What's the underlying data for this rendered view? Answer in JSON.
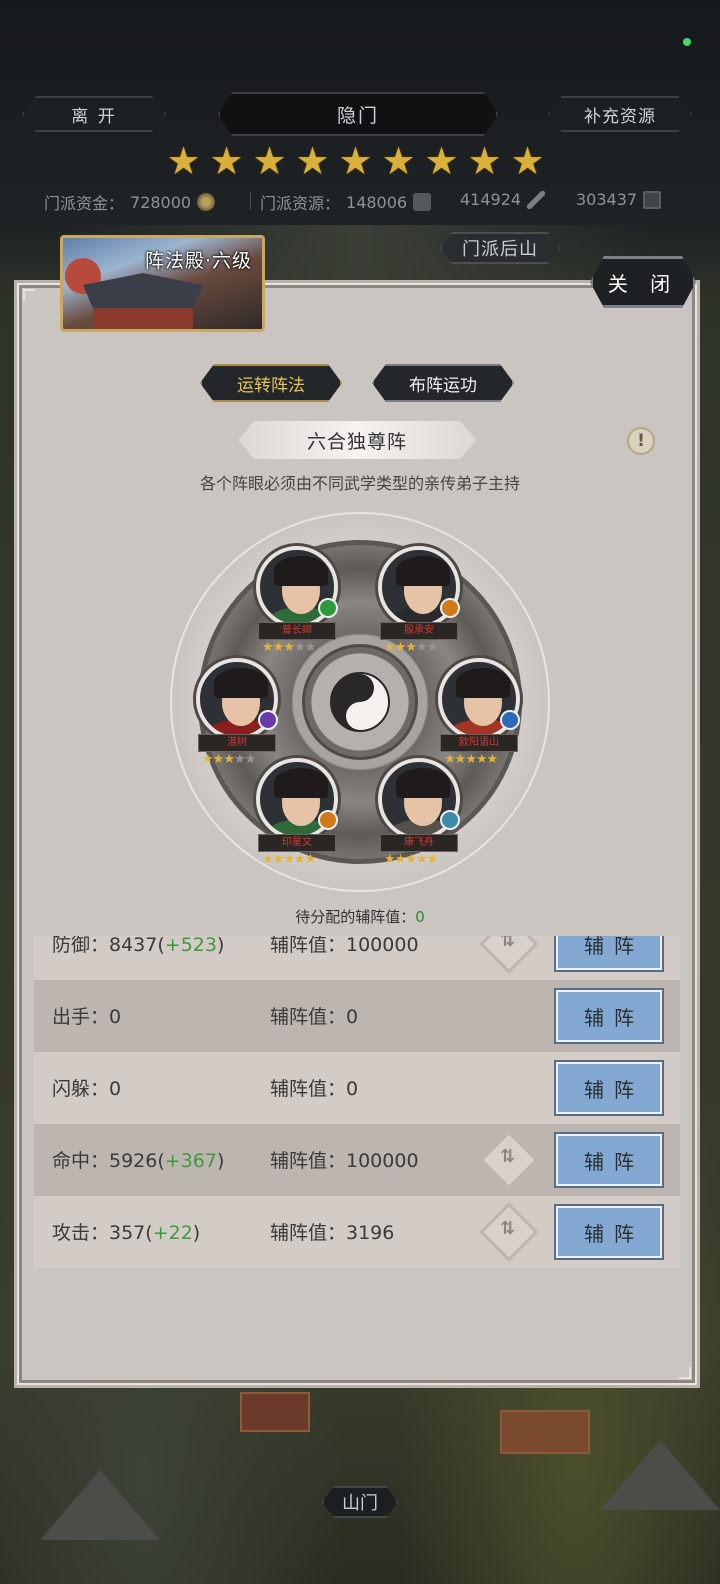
{
  "header": {
    "leave_label": "离 开",
    "title": "隐门",
    "resupply_label": "补充资源",
    "star_count": 9,
    "resources": [
      {
        "label": "门派资金：",
        "value": "728000",
        "icon": "coin-icon"
      },
      {
        "label": "门派资源：",
        "value": "148006",
        "icon": "bag-icon"
      },
      {
        "label": "",
        "value": "414924",
        "icon": "sword-icon"
      },
      {
        "label": "",
        "value": "303437",
        "icon": "box-icon"
      }
    ]
  },
  "map": {
    "back_mountain_label": "门派后山",
    "gate_label": "山门"
  },
  "panel": {
    "hall_title": "阵法殿·六级",
    "close_label": "关 闭",
    "tabs": [
      {
        "label": "运转阵法",
        "active": true
      },
      {
        "label": "布阵运功",
        "active": false
      }
    ],
    "formation_name": "六合独尊阵",
    "info_icon_text": "!",
    "rule_text": "各个阵眼必须由不同武学类型的亲传弟子主持",
    "disciples": [
      {
        "name": "曾长卿",
        "stars": 3,
        "max_stars": 5,
        "robe": "#2f6a3a",
        "badge": "#2e9a3e"
      },
      {
        "name": "殷承安",
        "stars": 3,
        "max_stars": 5,
        "robe": "#2a2a2e",
        "badge": "#d07a1a"
      },
      {
        "name": "湛树",
        "stars": 3,
        "max_stars": 5,
        "robe": "#8a1f1f",
        "badge": "#6a3aa8"
      },
      {
        "name": "欧阳语山",
        "stars": 5,
        "max_stars": 5,
        "robe": "#a43426",
        "badge": "#2a6ab8"
      },
      {
        "name": "印星文",
        "stars": 5,
        "max_stars": 5,
        "robe": "#2f6a3a",
        "badge": "#d07a1a"
      },
      {
        "name": "康飞舟",
        "stars": 5,
        "max_stars": 5,
        "robe": "#55504c",
        "badge": "#3a8aa8"
      }
    ],
    "pending_label": "待分配的辅阵值：",
    "pending_value": "0",
    "stats": [
      {
        "name": "防御：",
        "value": "8437",
        "bonus": "+523",
        "assist_label": "辅阵值：",
        "assist_value": "100000",
        "has_swap": true,
        "button": "辅阵"
      },
      {
        "name": "出手：",
        "value": "0",
        "bonus": "",
        "assist_label": "辅阵值：",
        "assist_value": "0",
        "has_swap": false,
        "button": "辅阵"
      },
      {
        "name": "闪躲：",
        "value": "0",
        "bonus": "",
        "assist_label": "辅阵值：",
        "assist_value": "0",
        "has_swap": false,
        "button": "辅阵"
      },
      {
        "name": "命中：",
        "value": "5926",
        "bonus": "+367",
        "assist_label": "辅阵值：",
        "assist_value": "100000",
        "has_swap": true,
        "button": "辅阵"
      },
      {
        "name": "攻击：",
        "value": "357",
        "bonus": "+22",
        "assist_label": "辅阵值：",
        "assist_value": "3196",
        "has_swap": true,
        "button": "辅阵"
      }
    ]
  },
  "colors": {
    "star_gold": "#d9b13a",
    "bonus_green": "#3f9a3f",
    "assist_button_blue": "#83a8d2",
    "active_tab_gold": "#e6c45a"
  }
}
